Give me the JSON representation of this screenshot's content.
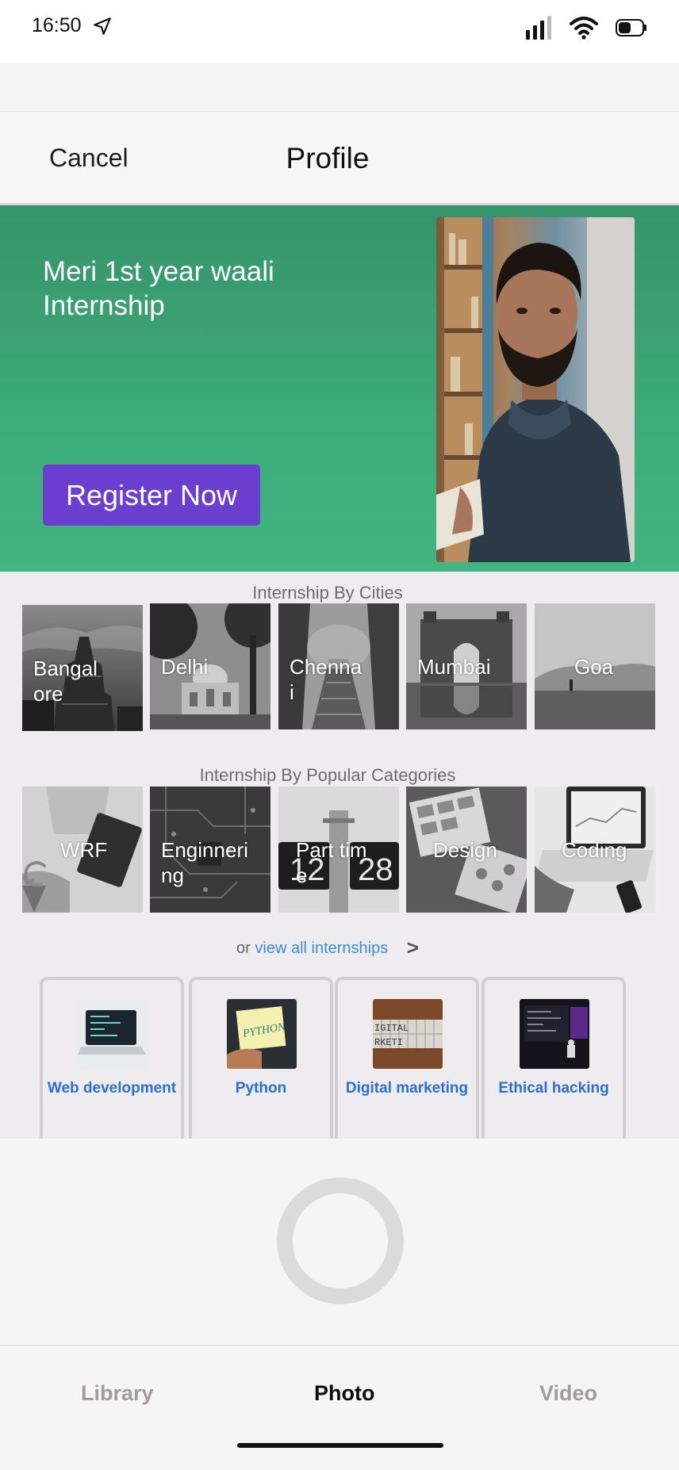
{
  "status_bar": {
    "time": "16:50"
  },
  "nav": {
    "cancel_label": "Cancel",
    "title": "Profile"
  },
  "hero": {
    "title": "Meri 1st year waali Internship",
    "register_label": "Register Now"
  },
  "cities": {
    "title": "Internship By Cities",
    "items": [
      {
        "label": "Bangalore"
      },
      {
        "label": "Delhi"
      },
      {
        "label": "Chennai"
      },
      {
        "label": "Mumbai"
      },
      {
        "label": "Goa"
      }
    ]
  },
  "categories": {
    "title": "Internship By Popular Categories",
    "items": [
      {
        "label": "WRF"
      },
      {
        "label": "Enginnering"
      },
      {
        "label": "Part time"
      },
      {
        "label": "Design"
      },
      {
        "label": "Coding"
      }
    ]
  },
  "view_all": {
    "prefix": "or",
    "link": "view all internships",
    "chevron": ">"
  },
  "courses": [
    {
      "label": "Web development"
    },
    {
      "label": "Python"
    },
    {
      "label": "Digital marketing"
    },
    {
      "label": "Ethical hacking"
    }
  ],
  "tabs": {
    "library": "Library",
    "photo": "Photo",
    "video": "Video"
  },
  "colors": {
    "hero_green": "#3daa79",
    "register_purple": "#6a3fd0",
    "link_blue": "#3a8ed5",
    "course_label_blue": "#2a6fd0"
  }
}
